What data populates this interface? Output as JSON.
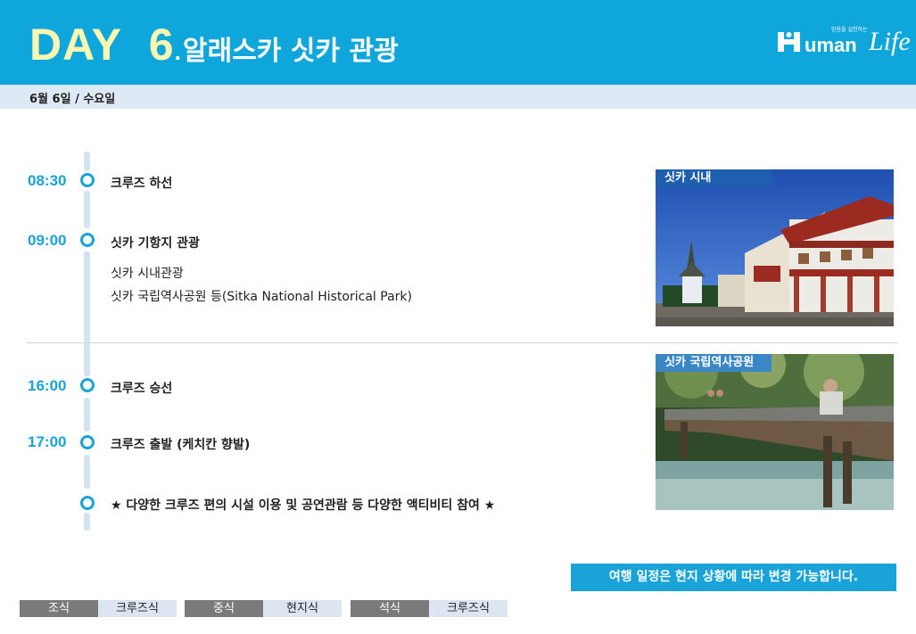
{
  "header": {
    "day_word": "DAY",
    "day_number": "6",
    "day_dot": ".",
    "title": "알래스카 싯카 관광",
    "logo_text": "uman",
    "logo_script": "Life",
    "logo_tagline": "믿음을 실천하는",
    "colors": {
      "header_bg": "#0fa6dc",
      "day_color": "#fbf7b0",
      "accent": "#1aa3d8"
    }
  },
  "date": "6월 6일 / 수요일",
  "schedule": [
    {
      "time": "08:30",
      "event": "크루즈 하선",
      "details": []
    },
    {
      "time": "09:00",
      "event": "싯카 기항지 관광",
      "details": [
        "싯카 시내관광",
        "싯카 국립역사공원 등(Sitka National Historical Park)"
      ]
    },
    {
      "time": "16:00",
      "event": "크루즈 승선",
      "details": []
    },
    {
      "time": "17:00",
      "event": "크루즈 출발 (케치칸 향발)",
      "details": []
    },
    {
      "time": "",
      "event": "★ 다양한 크루즈 편의 시설 이용 및 공연관람 등 다양한 액티비티 참여 ★",
      "details": []
    }
  ],
  "photos": [
    {
      "label": "싯카 시내",
      "icon": "town-photo"
    },
    {
      "label": "싯카 국립역사공원",
      "icon": "park-bridge-photo"
    }
  ],
  "notice": "여행 일정은 현지 상황에 따라 변경 가능합니다.",
  "meals": [
    {
      "label": "조식",
      "value": "크루즈식"
    },
    {
      "label": "중식",
      "value": "현지식"
    },
    {
      "label": "석식",
      "value": "크루즈식"
    }
  ]
}
